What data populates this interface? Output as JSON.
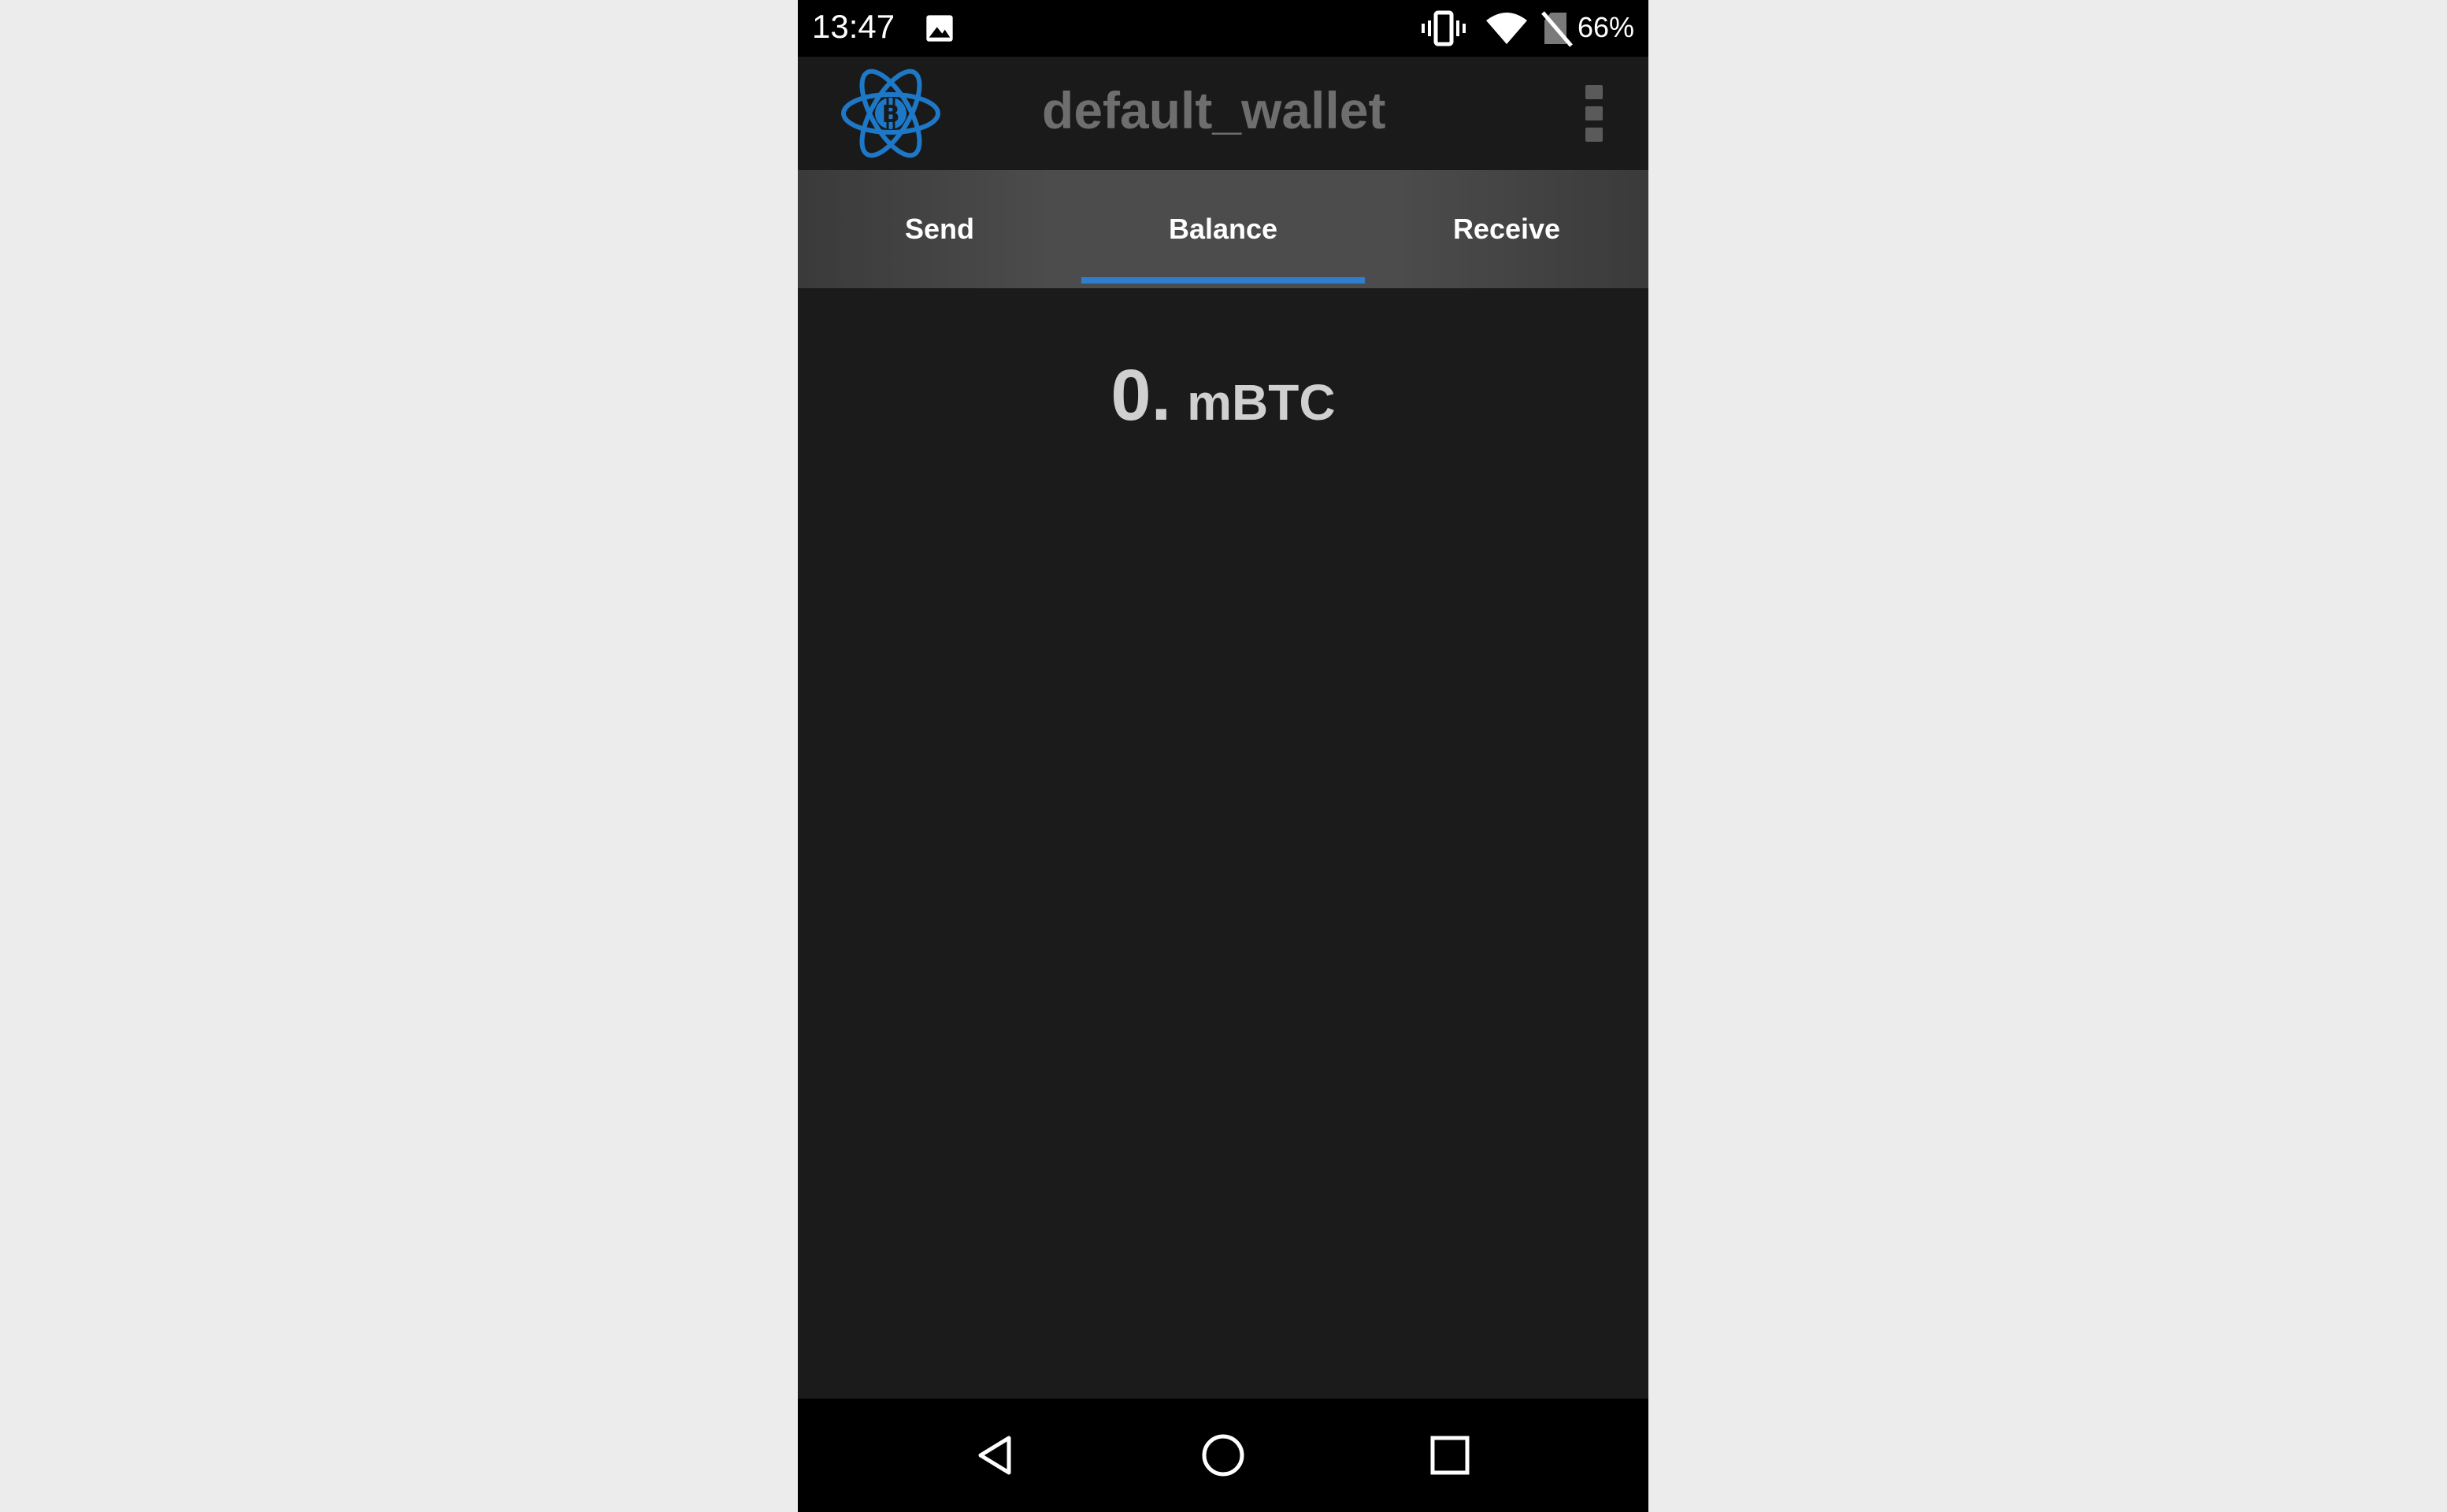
{
  "status_bar": {
    "time": "13:47",
    "battery": "66%",
    "icons": [
      "image-icon",
      "vibrate-icon",
      "wifi-icon",
      "no-sim-icon"
    ]
  },
  "app_bar": {
    "title": "default_wallet",
    "logo": "electrum-bitcoin-logo",
    "menu_icon": "overflow-menu-icon"
  },
  "tabs": [
    {
      "label": "Send",
      "selected": false
    },
    {
      "label": "Balance",
      "selected": true
    },
    {
      "label": "Receive",
      "selected": false
    }
  ],
  "balance": {
    "amount": "0.",
    "unit": "mBTC"
  },
  "nav_bar": {
    "icons": [
      "back-icon",
      "home-icon",
      "recents-icon"
    ]
  },
  "colors": {
    "accent": "#2f7fd0",
    "logo": "#1e78c8",
    "background": "#1b1b1b"
  }
}
